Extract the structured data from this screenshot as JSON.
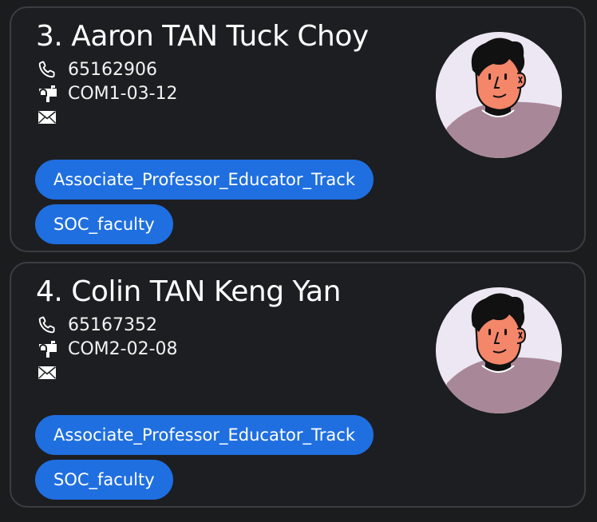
{
  "contacts": [
    {
      "name": "3. Aaron TAN Tuck Choy",
      "phone": "65162906",
      "office": "COM1-03-12",
      "email": "",
      "tags": [
        "Associate_Professor_Educator_Track",
        "SOC_faculty"
      ]
    },
    {
      "name": "4. Colin TAN Keng Yan",
      "phone": "65167352",
      "office": "COM2-02-08",
      "email": "",
      "tags": [
        "Associate_Professor_Educator_Track",
        "SOC_faculty"
      ]
    }
  ],
  "icons": {
    "phone": "phone-icon",
    "office": "mailbox-icon",
    "email": "envelope-icon"
  },
  "colors": {
    "background": "#1b1c1e",
    "card": "#1d1e21",
    "card_border": "#3b3d42",
    "tag": "#1f6fe0",
    "text": "#ffffff"
  }
}
